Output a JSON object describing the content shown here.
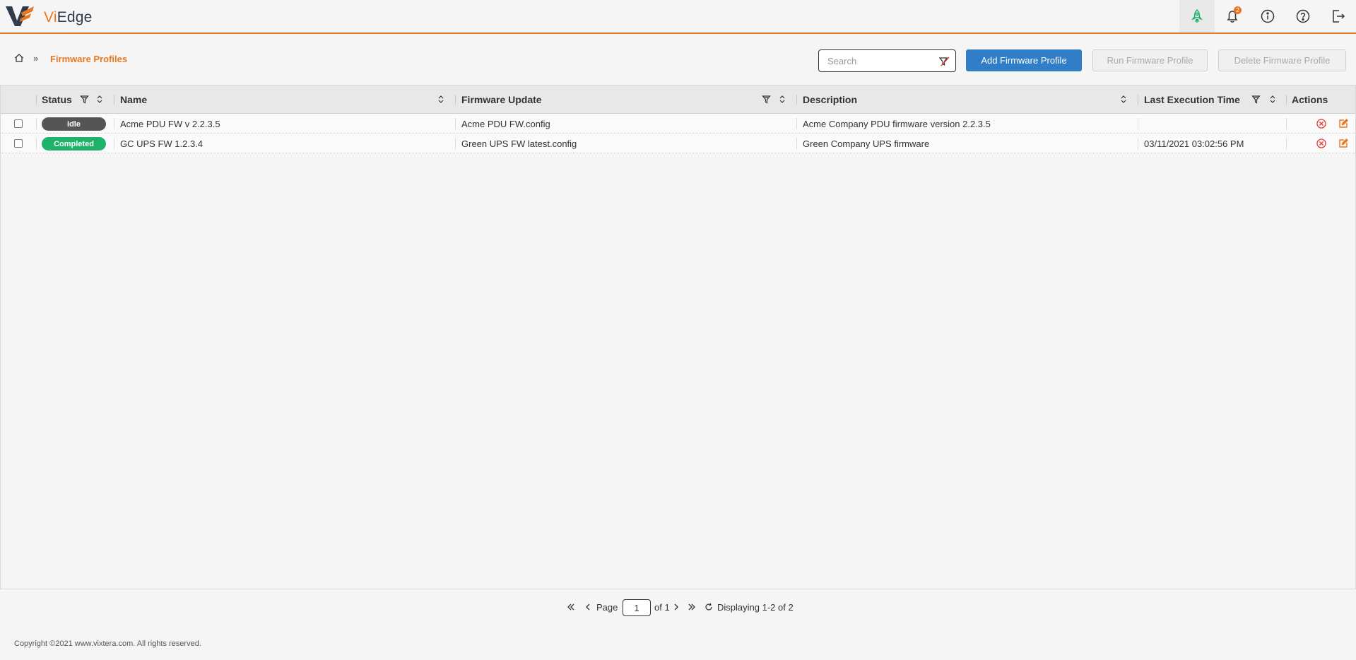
{
  "app": {
    "brand_prefix": "Vi",
    "brand_suffix": "Edge"
  },
  "topbar": {
    "icons": [
      "rocket-icon",
      "bell-icon",
      "info-icon",
      "help-icon",
      "logout-icon"
    ],
    "notification_count": "2"
  },
  "breadcrumb": {
    "separator": "»",
    "current": "Firmware Profiles"
  },
  "toolbar": {
    "search_placeholder": "Search",
    "add_label": "Add Firmware Profile",
    "run_label": "Run Firmware Profile",
    "delete_label": "Delete Firmware Profile"
  },
  "table": {
    "columns": [
      "Status",
      "Name",
      "Firmware Update",
      "Description",
      "Last Execution Time",
      "Actions"
    ],
    "rows": [
      {
        "status": "Idle",
        "status_color": "#555555",
        "name": "Acme PDU FW v 2.2.3.5",
        "firmware": "Acme PDU FW.config",
        "description": "Acme Company PDU firmware version 2.2.3.5",
        "last_exec": ""
      },
      {
        "status": "Completed",
        "status_color": "#1fb26b",
        "name": "GC UPS FW 1.2.3.4",
        "firmware": "Green UPS FW latest.config",
        "description": "Green Company UPS firmware",
        "last_exec": "03/11/2021 03:02:56 PM"
      }
    ]
  },
  "pager": {
    "page_label": "Page",
    "page_value": "1",
    "of_label": "of 1",
    "display_text": "Displaying 1-2 of 2"
  },
  "footer": {
    "copyright": "Copyright ©2021 www.vixtera.com. All rights reserved."
  },
  "colors": {
    "accent": "#e87722",
    "primary": "#2f7ec7",
    "danger": "#e53935"
  }
}
